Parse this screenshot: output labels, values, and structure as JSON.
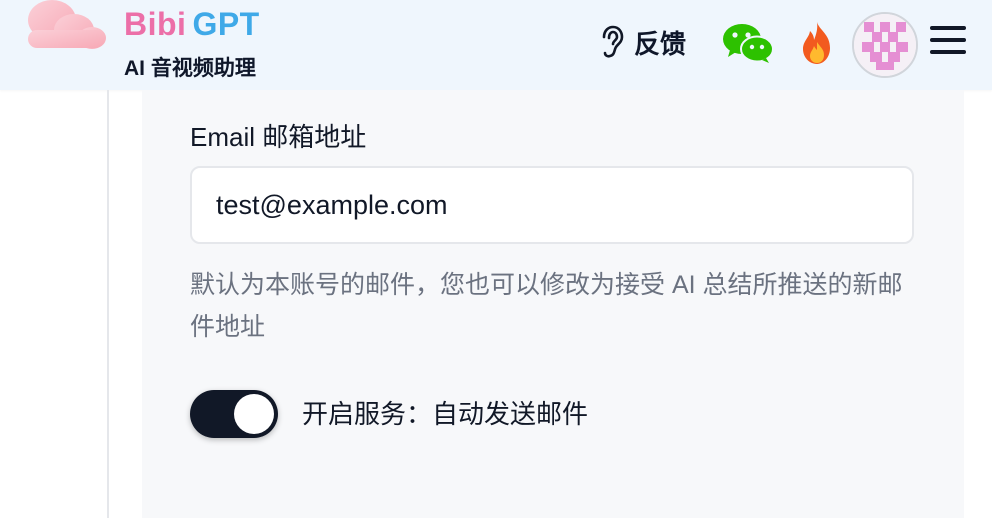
{
  "header": {
    "brand_part1": "Bibi",
    "brand_part2": "GPT",
    "tagline": "AI 音视频助理",
    "feedback_label": "反馈",
    "icons": [
      "cloud-logo-icon",
      "ear-icon",
      "wechat-icon",
      "fire-icon",
      "avatar",
      "hamburger-menu-icon"
    ]
  },
  "form": {
    "email_label": "Email 邮箱地址",
    "email_value": "test@example.com",
    "help_text": "默认为本账号的邮件，您也可以修改为接受 AI 总结所推送的新邮件地址",
    "toggle_on": true,
    "toggle_label": "开启服务：自动发送邮件"
  },
  "colors": {
    "brand_pink": "#ec6fa8",
    "brand_blue": "#3fa9e8",
    "header_bg": "#eff6fd",
    "toggle_on": "#111827",
    "wechat_green": "#2dc100"
  }
}
